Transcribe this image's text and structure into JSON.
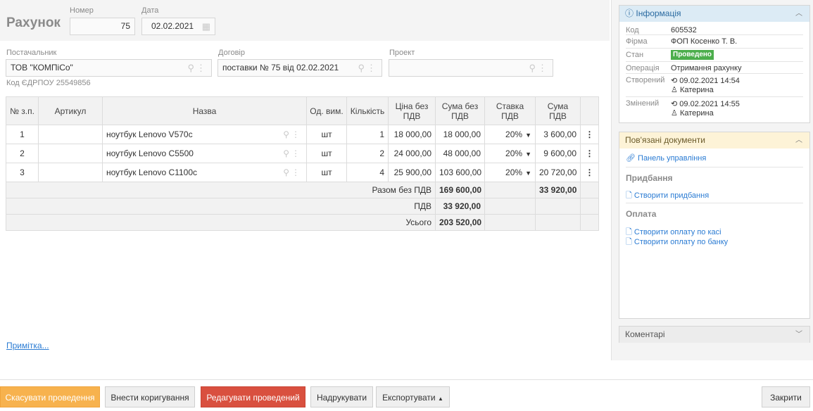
{
  "header": {
    "title": "Рахунок",
    "number_label": "Номер",
    "number_value": "75",
    "date_label": "Дата",
    "date_value": "02.02.2021"
  },
  "fields": {
    "supplier_label": "Постачальник",
    "supplier_value": "ТОВ \"КОМПіСо\"",
    "contract_label": "Договір",
    "contract_value": "поставки № 75 від 02.02.2021",
    "project_label": "Проект",
    "project_value": "",
    "edrpou": "Код ЄДРПОУ 25549856"
  },
  "table": {
    "headers": {
      "num": "№ з.п.",
      "article": "Артикул",
      "name": "Назва",
      "unit": "Од. вим.",
      "qty": "Кількість",
      "price_1": "Ціна без",
      "price_2": "ПДВ",
      "sum_1": "Сума без",
      "sum_2": "ПДВ",
      "rate_1": "Ставка",
      "rate_2": "ПДВ",
      "vat_1": "Сума",
      "vat_2": "ПДВ"
    },
    "rows": [
      {
        "num": "1",
        "article": "",
        "name": "ноутбук Lenovo V570c",
        "unit": "шт",
        "qty": "1",
        "price": "18 000,00",
        "sum": "18 000,00",
        "rate": "20%",
        "vat": "3 600,00"
      },
      {
        "num": "2",
        "article": "",
        "name": "ноутбук Lenovo C5500",
        "unit": "шт",
        "qty": "2",
        "price": "24 000,00",
        "sum": "48 000,00",
        "rate": "20%",
        "vat": "9 600,00"
      },
      {
        "num": "3",
        "article": "",
        "name": "ноутбук Lenovo C1100c",
        "unit": "шт",
        "qty": "4",
        "price": "25 900,00",
        "sum": "103 600,00",
        "rate": "20%",
        "vat": "20 720,00"
      }
    ],
    "totals": {
      "subtotal_label": "Разом без ПДВ",
      "subtotal_value": "169 600,00",
      "subtotal_vat": "33 920,00",
      "vat_label": "ПДВ",
      "vat_value": "33 920,00",
      "total_label": "Усього",
      "total_value": "203 520,00"
    }
  },
  "note_link": "Примітка...",
  "info": {
    "title": "Інформація",
    "code_label": "Код",
    "code_value": "605532",
    "firm_label": "Фірма",
    "firm_value": "ФОП Косенко Т. В.",
    "state_label": "Стан",
    "state_value": "Проведено",
    "operation_label": "Операція",
    "operation_value": "Отримання рахунку",
    "created_label": "Створений",
    "created_date": "09.02.2021 14:54",
    "created_user": "Катерина",
    "changed_label": "Змінений",
    "changed_date": "09.02.2021 14:55",
    "changed_user": "Катерина"
  },
  "related": {
    "title": "Пов'язані документи",
    "control_panel": "Панель управління",
    "purchase_section": "Придбання",
    "create_purchase": "Створити придбання",
    "payment_section": "Оплата",
    "create_cash_payment": "Створити оплату по касі",
    "create_bank_payment": "Створити оплату по банку"
  },
  "comments": {
    "title": "Коментарі"
  },
  "buttons": {
    "cancel_posting": "Скасувати проведення",
    "make_corrections": "Внести коригування",
    "edit_posted": "Редагувати проведений",
    "print": "Надрукувати",
    "export": "Експортувати",
    "close": "Закрити"
  },
  "colors": {
    "accent_link": "#2a7bd3",
    "posted_badge": "#4cae4c",
    "cancel_button": "#f7b24e",
    "edit_button": "#d9503f"
  }
}
